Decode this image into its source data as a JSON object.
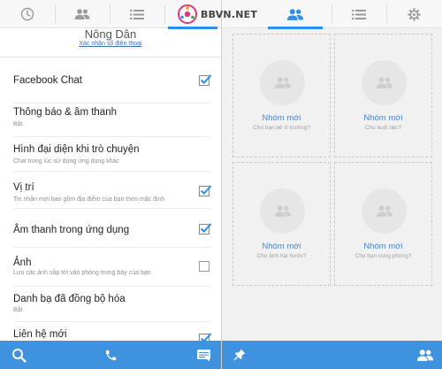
{
  "colors": {
    "accent": "#2e8ef0",
    "bottom_bar": "#3e92de",
    "link": "#3b6fb5"
  },
  "left": {
    "tabs": [
      {
        "icon": "clock-icon",
        "active": false
      },
      {
        "icon": "people-icon",
        "active": false
      },
      {
        "icon": "list-icon",
        "active": false
      },
      {
        "icon": "settings-icon",
        "active": true
      }
    ],
    "profile": {
      "name": "Nông Dân",
      "link": "Xác nhận số điện thoại"
    },
    "settings": [
      {
        "title": "Facebook Chat",
        "sub": "",
        "checked": true
      },
      {
        "title": "Thông báo & âm thanh",
        "sub": "Bật",
        "checked": null
      },
      {
        "title": "Hình đại diện khi trò chuyện",
        "sub": "Chat trong lúc sử dụng ứng dụng khác",
        "checked": null
      },
      {
        "title": "Vị trí",
        "sub": "Tin nhắn mới bao gồm địa điểm của bạn theo mặc định",
        "checked": true
      },
      {
        "title": "Âm thanh trong ứng dụng",
        "sub": "",
        "checked": true
      },
      {
        "title": "Ảnh",
        "sub": "Lưu các ảnh sắp tới vào phòng trưng bày của bạn",
        "checked": false
      },
      {
        "title": "Danh bạ đã đồng bộ hóa",
        "sub": "Bật",
        "checked": null
      },
      {
        "title": "Liên hệ mới",
        "sub": "",
        "checked": true
      }
    ],
    "bottom": [
      "search-icon",
      "phone-icon",
      "message-icon"
    ]
  },
  "watermark": {
    "text": "BBVN.NET"
  },
  "right": {
    "tabs": [
      {
        "icon": "people-icon",
        "active": true
      },
      {
        "icon": "list-icon",
        "active": false
      },
      {
        "icon": "gear-icon",
        "active": false
      }
    ],
    "groups": [
      {
        "title": "Nhóm mới",
        "sub": "Cho bạn bè ở trường?"
      },
      {
        "title": "Nhóm mới",
        "sub": "Cho buổi tiệc?"
      },
      {
        "title": "Nhóm mới",
        "sub": "Cho ảnh hài hước?"
      },
      {
        "title": "Nhóm mới",
        "sub": "Cho bạn cùng phòng?"
      }
    ],
    "bottom": [
      "pin-icon",
      "group-icon"
    ]
  }
}
